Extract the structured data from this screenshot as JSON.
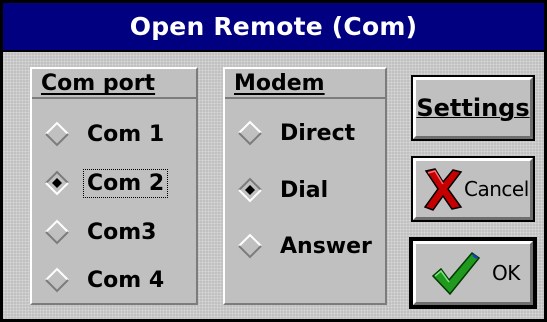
{
  "window": {
    "title": "Open Remote (Com)"
  },
  "com_port": {
    "title": "Com port",
    "options": [
      {
        "label": "Com 1",
        "selected": false,
        "focused": false
      },
      {
        "label": "Com 2",
        "selected": true,
        "focused": true
      },
      {
        "label": "Com3",
        "selected": false,
        "focused": false
      },
      {
        "label": "Com 4",
        "selected": false,
        "focused": false
      }
    ]
  },
  "modem": {
    "title": "Modem",
    "options": [
      {
        "label": "Direct",
        "selected": false
      },
      {
        "label": "Dial",
        "selected": true
      },
      {
        "label": "Answer",
        "selected": false
      }
    ]
  },
  "buttons": {
    "settings_label": "Settings",
    "cancel_label": "Cancel",
    "ok_label": "OK"
  },
  "icons": {
    "cancel": "red-x-icon",
    "ok": "green-checkmark-icon"
  },
  "colors": {
    "titlebar": "#000080",
    "face": "#c0c0c0",
    "cancel_x": "#c40000",
    "ok_check": "#1f9a1f"
  }
}
